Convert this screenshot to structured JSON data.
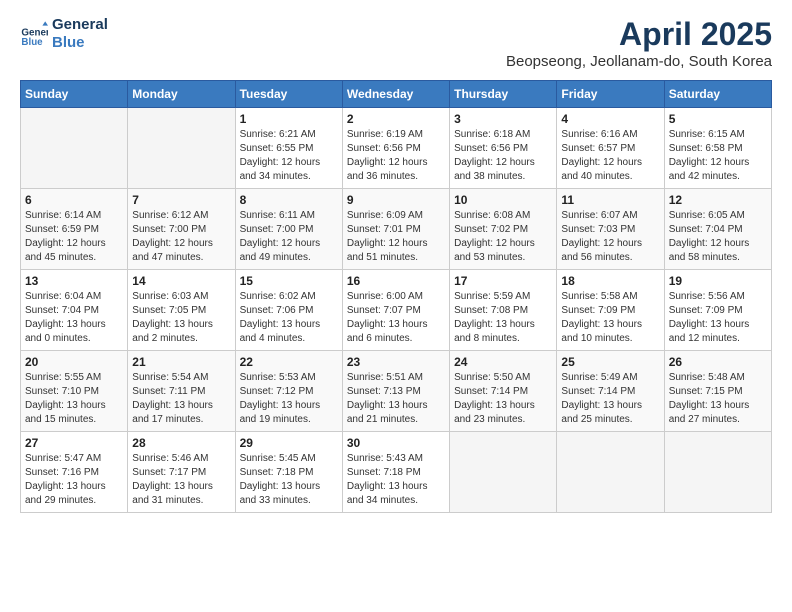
{
  "logo": {
    "line1": "General",
    "line2": "Blue"
  },
  "title": "April 2025",
  "subtitle": "Beopseong, Jeollanam-do, South Korea",
  "headers": [
    "Sunday",
    "Monday",
    "Tuesday",
    "Wednesday",
    "Thursday",
    "Friday",
    "Saturday"
  ],
  "weeks": [
    [
      {
        "day": "",
        "info": ""
      },
      {
        "day": "",
        "info": ""
      },
      {
        "day": "1",
        "info": "Sunrise: 6:21 AM\nSunset: 6:55 PM\nDaylight: 12 hours and 34 minutes."
      },
      {
        "day": "2",
        "info": "Sunrise: 6:19 AM\nSunset: 6:56 PM\nDaylight: 12 hours and 36 minutes."
      },
      {
        "day": "3",
        "info": "Sunrise: 6:18 AM\nSunset: 6:56 PM\nDaylight: 12 hours and 38 minutes."
      },
      {
        "day": "4",
        "info": "Sunrise: 6:16 AM\nSunset: 6:57 PM\nDaylight: 12 hours and 40 minutes."
      },
      {
        "day": "5",
        "info": "Sunrise: 6:15 AM\nSunset: 6:58 PM\nDaylight: 12 hours and 42 minutes."
      }
    ],
    [
      {
        "day": "6",
        "info": "Sunrise: 6:14 AM\nSunset: 6:59 PM\nDaylight: 12 hours and 45 minutes."
      },
      {
        "day": "7",
        "info": "Sunrise: 6:12 AM\nSunset: 7:00 PM\nDaylight: 12 hours and 47 minutes."
      },
      {
        "day": "8",
        "info": "Sunrise: 6:11 AM\nSunset: 7:00 PM\nDaylight: 12 hours and 49 minutes."
      },
      {
        "day": "9",
        "info": "Sunrise: 6:09 AM\nSunset: 7:01 PM\nDaylight: 12 hours and 51 minutes."
      },
      {
        "day": "10",
        "info": "Sunrise: 6:08 AM\nSunset: 7:02 PM\nDaylight: 12 hours and 53 minutes."
      },
      {
        "day": "11",
        "info": "Sunrise: 6:07 AM\nSunset: 7:03 PM\nDaylight: 12 hours and 56 minutes."
      },
      {
        "day": "12",
        "info": "Sunrise: 6:05 AM\nSunset: 7:04 PM\nDaylight: 12 hours and 58 minutes."
      }
    ],
    [
      {
        "day": "13",
        "info": "Sunrise: 6:04 AM\nSunset: 7:04 PM\nDaylight: 13 hours and 0 minutes."
      },
      {
        "day": "14",
        "info": "Sunrise: 6:03 AM\nSunset: 7:05 PM\nDaylight: 13 hours and 2 minutes."
      },
      {
        "day": "15",
        "info": "Sunrise: 6:02 AM\nSunset: 7:06 PM\nDaylight: 13 hours and 4 minutes."
      },
      {
        "day": "16",
        "info": "Sunrise: 6:00 AM\nSunset: 7:07 PM\nDaylight: 13 hours and 6 minutes."
      },
      {
        "day": "17",
        "info": "Sunrise: 5:59 AM\nSunset: 7:08 PM\nDaylight: 13 hours and 8 minutes."
      },
      {
        "day": "18",
        "info": "Sunrise: 5:58 AM\nSunset: 7:09 PM\nDaylight: 13 hours and 10 minutes."
      },
      {
        "day": "19",
        "info": "Sunrise: 5:56 AM\nSunset: 7:09 PM\nDaylight: 13 hours and 12 minutes."
      }
    ],
    [
      {
        "day": "20",
        "info": "Sunrise: 5:55 AM\nSunset: 7:10 PM\nDaylight: 13 hours and 15 minutes."
      },
      {
        "day": "21",
        "info": "Sunrise: 5:54 AM\nSunset: 7:11 PM\nDaylight: 13 hours and 17 minutes."
      },
      {
        "day": "22",
        "info": "Sunrise: 5:53 AM\nSunset: 7:12 PM\nDaylight: 13 hours and 19 minutes."
      },
      {
        "day": "23",
        "info": "Sunrise: 5:51 AM\nSunset: 7:13 PM\nDaylight: 13 hours and 21 minutes."
      },
      {
        "day": "24",
        "info": "Sunrise: 5:50 AM\nSunset: 7:14 PM\nDaylight: 13 hours and 23 minutes."
      },
      {
        "day": "25",
        "info": "Sunrise: 5:49 AM\nSunset: 7:14 PM\nDaylight: 13 hours and 25 minutes."
      },
      {
        "day": "26",
        "info": "Sunrise: 5:48 AM\nSunset: 7:15 PM\nDaylight: 13 hours and 27 minutes."
      }
    ],
    [
      {
        "day": "27",
        "info": "Sunrise: 5:47 AM\nSunset: 7:16 PM\nDaylight: 13 hours and 29 minutes."
      },
      {
        "day": "28",
        "info": "Sunrise: 5:46 AM\nSunset: 7:17 PM\nDaylight: 13 hours and 31 minutes."
      },
      {
        "day": "29",
        "info": "Sunrise: 5:45 AM\nSunset: 7:18 PM\nDaylight: 13 hours and 33 minutes."
      },
      {
        "day": "30",
        "info": "Sunrise: 5:43 AM\nSunset: 7:18 PM\nDaylight: 13 hours and 34 minutes."
      },
      {
        "day": "",
        "info": ""
      },
      {
        "day": "",
        "info": ""
      },
      {
        "day": "",
        "info": ""
      }
    ]
  ]
}
